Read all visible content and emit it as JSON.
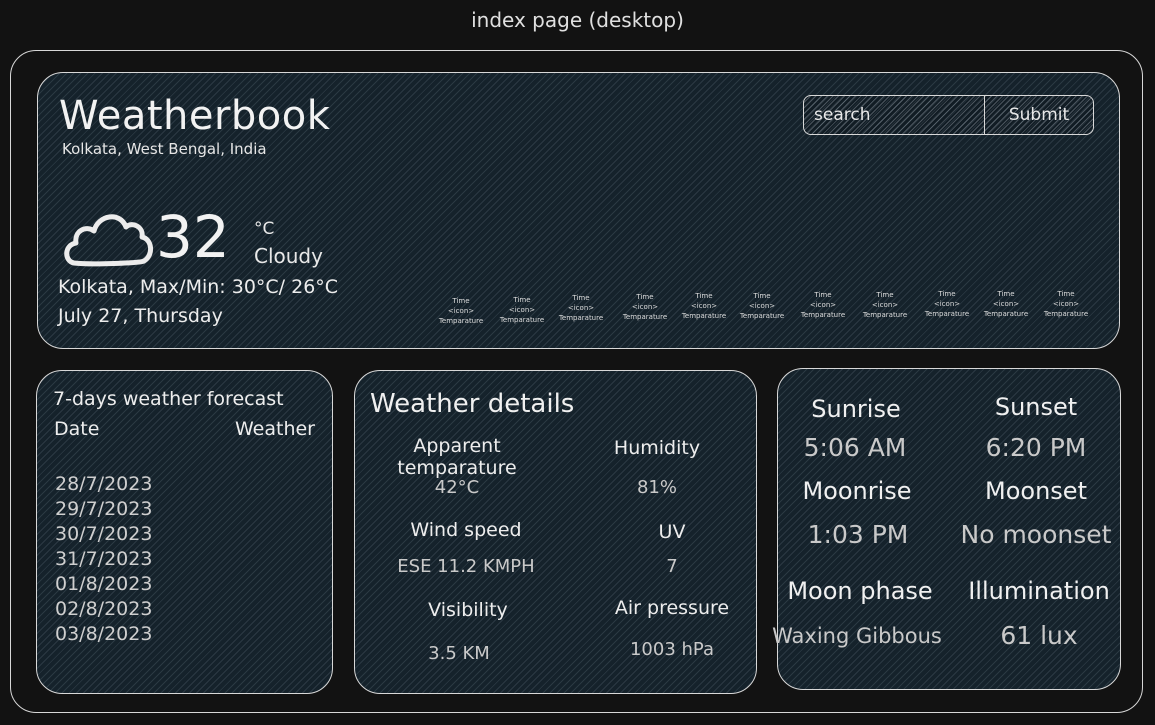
{
  "page_caption": "index page (desktop)",
  "header": {
    "brand": "Weatherbook",
    "location": "Kolkata, West Bengal, India",
    "search": {
      "placeholder": "search"
    },
    "submit_label": "Submit"
  },
  "current": {
    "icon": "cloud-icon",
    "temperature": "32",
    "unit": "°C",
    "condition": "Cloudy",
    "minmax": "Kolkata, Max/Min: 30°C/ 26°C",
    "date": "July 27, Thursday"
  },
  "hourly": [
    {
      "time": "Time",
      "icon": "<icon>",
      "temp": "Temparature"
    },
    {
      "time": "Time",
      "icon": "<icon>",
      "temp": "Temparature"
    },
    {
      "time": "Time",
      "icon": "<icon>",
      "temp": "Temparature"
    },
    {
      "time": "Time",
      "icon": "<icon>",
      "temp": "Temparature"
    },
    {
      "time": "Time",
      "icon": "<icon>",
      "temp": "Temparature"
    },
    {
      "time": "Time",
      "icon": "<icon>",
      "temp": "Temparature"
    },
    {
      "time": "Time",
      "icon": "<icon>",
      "temp": "Temparature"
    },
    {
      "time": "Time",
      "icon": "<icon>",
      "temp": "Temparature"
    },
    {
      "time": "Time",
      "icon": "<icon>",
      "temp": "Temparature"
    },
    {
      "time": "Time",
      "icon": "<icon>",
      "temp": "Temparature"
    },
    {
      "time": "Time",
      "icon": "<icon>",
      "temp": "Temparature"
    }
  ],
  "forecast": {
    "title": "7-days weather forecast",
    "col_date": "Date",
    "col_weather": "Weather",
    "dates": [
      "28/7/2023",
      "29/7/2023",
      "30/7/2023",
      "31/7/2023",
      "01/8/2023",
      "02/8/2023",
      "03/8/2023"
    ]
  },
  "details": {
    "title": "Weather details",
    "items": [
      {
        "label": "Apparent temparature",
        "value": "42°C"
      },
      {
        "label": "Humidity",
        "value": "81%"
      },
      {
        "label": "Wind speed",
        "value": "ESE 11.2 KMPH"
      },
      {
        "label": "UV",
        "value": "7"
      },
      {
        "label": "Visibility",
        "value": "3.5 KM"
      },
      {
        "label": "Air pressure",
        "value": "1003 hPa"
      }
    ]
  },
  "astro": {
    "items": [
      {
        "label": "Sunrise",
        "value": "5:06 AM"
      },
      {
        "label": "Sunset",
        "value": "6:20 PM"
      },
      {
        "label": "Moonrise",
        "value": "1:03 PM"
      },
      {
        "label": "Moonset",
        "value": "No moonset"
      },
      {
        "label": "Moon phase",
        "value": "Waxing Gibbous"
      },
      {
        "label": "Illumination",
        "value": "61 lux"
      }
    ]
  }
}
